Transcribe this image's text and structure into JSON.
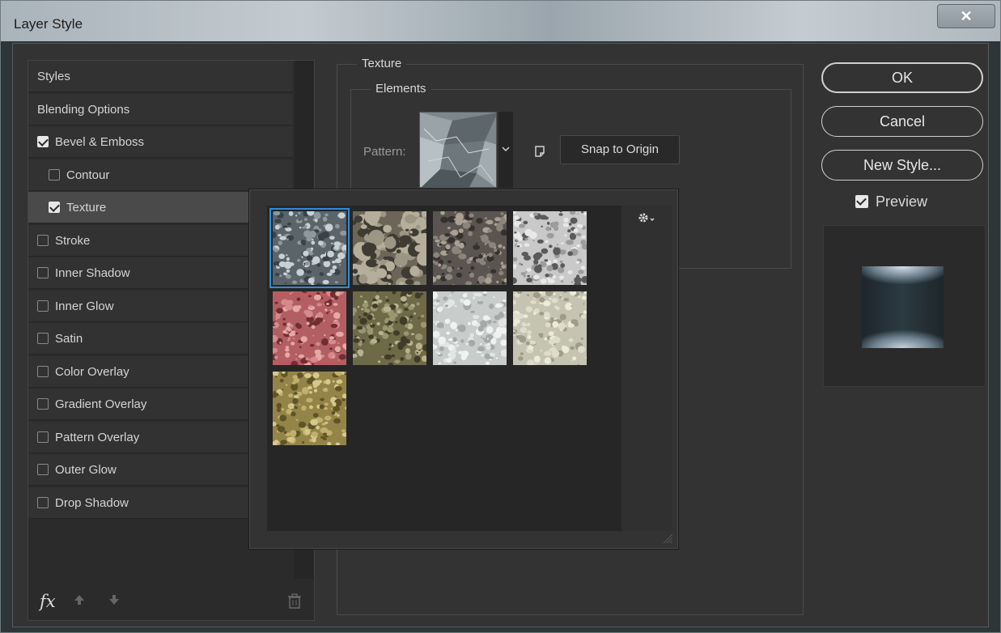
{
  "window": {
    "title": "Layer Style",
    "close_label": "✕"
  },
  "style_list": {
    "items": [
      {
        "label": "Styles",
        "checkbox": false,
        "checked": false,
        "sub": false,
        "selected": false
      },
      {
        "label": "Blending Options",
        "checkbox": false,
        "checked": false,
        "sub": false,
        "selected": false
      },
      {
        "label": "Bevel & Emboss",
        "checkbox": true,
        "checked": true,
        "sub": false,
        "selected": false
      },
      {
        "label": "Contour",
        "checkbox": true,
        "checked": false,
        "sub": true,
        "selected": false
      },
      {
        "label": "Texture",
        "checkbox": true,
        "checked": true,
        "sub": true,
        "selected": true
      },
      {
        "label": "Stroke",
        "checkbox": true,
        "checked": false,
        "sub": false,
        "selected": false
      },
      {
        "label": "Inner Shadow",
        "checkbox": true,
        "checked": false,
        "sub": false,
        "selected": false
      },
      {
        "label": "Inner Glow",
        "checkbox": true,
        "checked": false,
        "sub": false,
        "selected": false
      },
      {
        "label": "Satin",
        "checkbox": true,
        "checked": false,
        "sub": false,
        "selected": false
      },
      {
        "label": "Color Overlay",
        "checkbox": true,
        "checked": false,
        "sub": false,
        "selected": false
      },
      {
        "label": "Gradient Overlay",
        "checkbox": true,
        "checked": false,
        "sub": false,
        "selected": false
      },
      {
        "label": "Pattern Overlay",
        "checkbox": true,
        "checked": false,
        "sub": false,
        "selected": false
      },
      {
        "label": "Outer Glow",
        "checkbox": true,
        "checked": false,
        "sub": false,
        "selected": false
      },
      {
        "label": "Drop Shadow",
        "checkbox": true,
        "checked": false,
        "sub": false,
        "selected": false
      }
    ],
    "footer": {
      "fx_label": "fx",
      "up_icon": "arrow-up-icon",
      "down_icon": "arrow-down-icon",
      "trash_icon": "trash-icon"
    }
  },
  "texture_panel": {
    "group_label": "Texture",
    "elements_label": "Elements",
    "pattern_label": "Pattern:",
    "snap_button": "Snap to Origin"
  },
  "pattern_picker": {
    "selected_index": 0,
    "gear_icon": "gear-icon",
    "patterns": [
      {
        "name": "gray-stone",
        "colors": [
          "#5b6468",
          "#8f999d",
          "#3a4246",
          "#c7d0d3"
        ]
      },
      {
        "name": "pebbles",
        "colors": [
          "#6b6658",
          "#9c9684",
          "#3e3b33",
          "#b5ae9a"
        ]
      },
      {
        "name": "gravel",
        "colors": [
          "#5a5550",
          "#8b847a",
          "#35322e",
          "#a99f92"
        ]
      },
      {
        "name": "granite",
        "colors": [
          "#c9c9c9",
          "#e8e8e8",
          "#5a5a5a",
          "#9c9c9c"
        ]
      },
      {
        "name": "red-rocks",
        "colors": [
          "#b35f62",
          "#d58a8b",
          "#6e2f33",
          "#e4a8a6"
        ]
      },
      {
        "name": "mossy-stone",
        "colors": [
          "#6e6a48",
          "#9c9670",
          "#3f3d2a",
          "#b8b38e"
        ]
      },
      {
        "name": "marble",
        "colors": [
          "#c8ccca",
          "#e2e5e3",
          "#a5aaa8",
          "#f0f2f1"
        ]
      },
      {
        "name": "pale-stone",
        "colors": [
          "#c5c4b2",
          "#dedcca",
          "#9f9d88",
          "#ecebd9"
        ]
      },
      {
        "name": "sand-gravel",
        "colors": [
          "#948448",
          "#c1b06d",
          "#5f5428",
          "#d6c88a"
        ]
      }
    ]
  },
  "actions": {
    "ok": "OK",
    "cancel": "Cancel",
    "new_style": "New Style...",
    "preview_label": "Preview",
    "preview_checked": true
  }
}
